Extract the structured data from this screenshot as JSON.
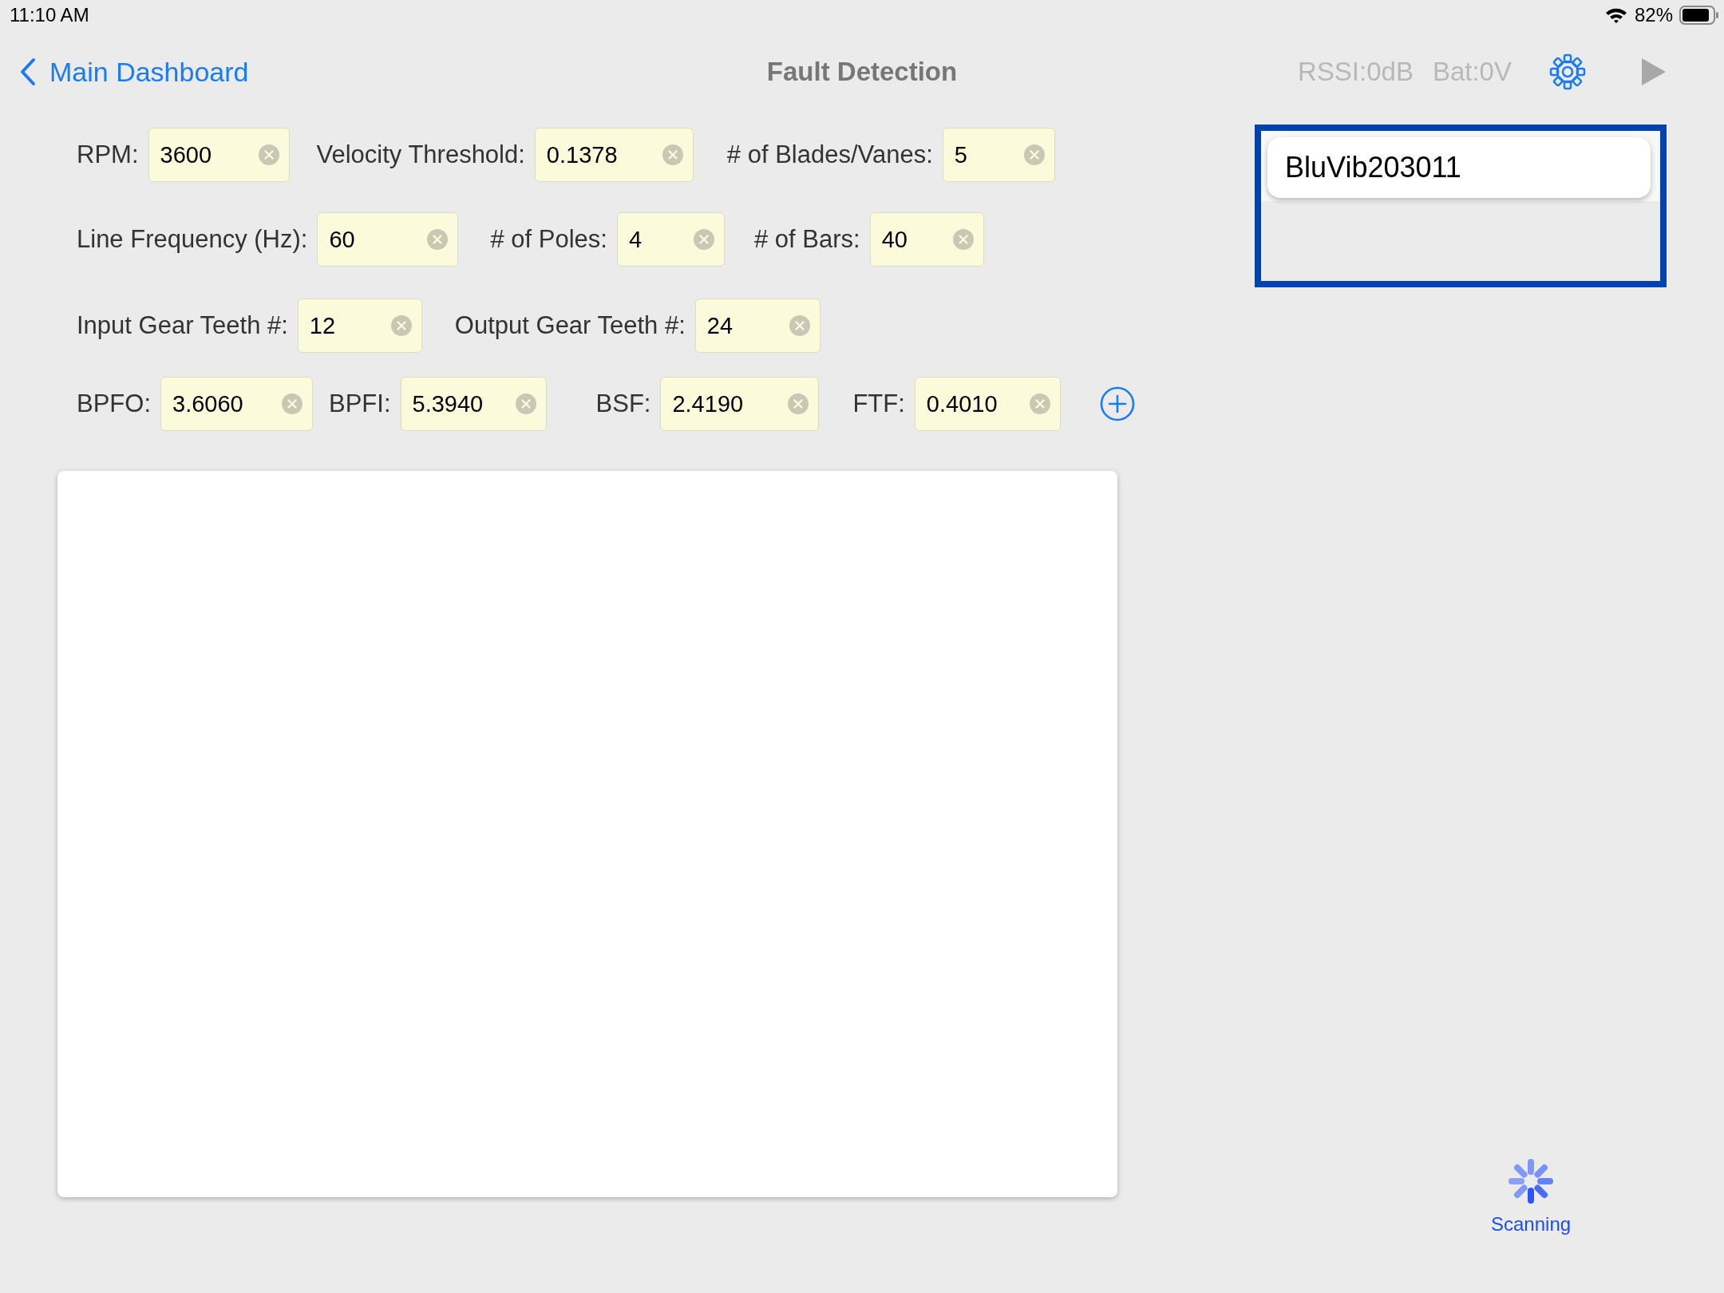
{
  "status_bar": {
    "time": "11:10 AM",
    "battery_text": "82%"
  },
  "nav": {
    "back_label": "Main Dashboard",
    "title": "Fault Detection",
    "rssi": "RSSI:0dB",
    "battery": "Bat:0V"
  },
  "parameter_rows": [
    {
      "fields": [
        {
          "label": "RPM:",
          "value": "3600"
        },
        {
          "label": "Velocity Threshold:",
          "value": "0.1378"
        },
        {
          "label": "# of Blades/Vanes:",
          "value": "5"
        }
      ]
    },
    {
      "fields": [
        {
          "label": "Line Frequency (Hz):",
          "value": "60"
        },
        {
          "label": "# of Poles:",
          "value": "4"
        },
        {
          "label": "# of Bars:",
          "value": "40"
        }
      ]
    },
    {
      "fields": [
        {
          "label": "Input Gear Teeth #:",
          "value": "12"
        },
        {
          "label": "Output Gear Teeth #:",
          "value": "24"
        }
      ]
    },
    {
      "fields": [
        {
          "label": "BPFO:",
          "value": "3.6060"
        },
        {
          "label": "BPFI:",
          "value": "5.3940"
        },
        {
          "label": "BSF:",
          "value": "2.4190"
        },
        {
          "label": "FTF:",
          "value": "0.4010"
        }
      ],
      "add_button": true
    }
  ],
  "devices": [
    {
      "name": "BluVib203011"
    }
  ],
  "scanning": {
    "label": "Scanning"
  }
}
